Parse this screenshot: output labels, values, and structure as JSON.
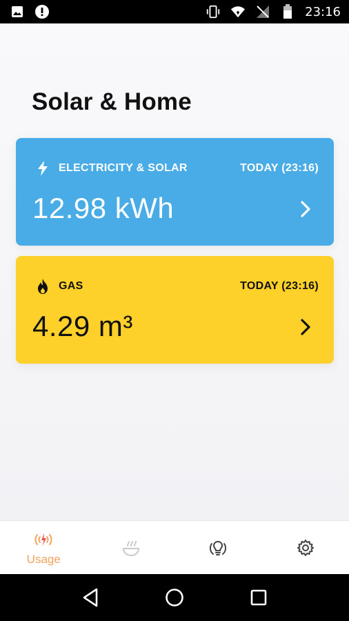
{
  "status_bar": {
    "time": "23:16",
    "icons_left": [
      "image-icon",
      "alert-icon"
    ],
    "icons_right": [
      "vibrate-icon",
      "wifi-icon",
      "no-signal-icon",
      "battery-icon"
    ]
  },
  "page": {
    "title": "Solar & Home"
  },
  "cards": {
    "electricity": {
      "label": "ELECTRICITY & SOLAR",
      "date": "TODAY (23:16)",
      "value": "12.98 kWh",
      "icon": "lightning-icon",
      "color": "#4aace6"
    },
    "gas": {
      "label": "GAS",
      "date": "TODAY (23:16)",
      "value": "4.29 m³",
      "icon": "flame-icon",
      "color": "#fdd02a"
    }
  },
  "bottom_nav": {
    "usage_label": "Usage",
    "items": [
      "usage-icon",
      "cooking-pot-icon",
      "lightbulb-icon",
      "gear-icon"
    ],
    "active_color": "#f5a25d"
  },
  "system_nav": [
    "back-icon",
    "home-icon",
    "recents-icon"
  ]
}
